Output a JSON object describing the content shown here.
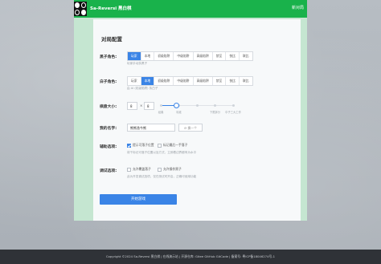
{
  "header": {
    "brand": "Sa-Reversi 黑白棋",
    "new_game": "新对局"
  },
  "config": {
    "title": "对局配置",
    "black_role": {
      "label": "黑子角色:",
      "options": [
        "玩家",
        "本地",
        "初级陷阱",
        "中级陷阱",
        "高级陷阱",
        "禁至",
        "快比",
        "联比"
      ],
      "active_index": 0,
      "hint": "玩家手动执黑子"
    },
    "white_role": {
      "label": "白子角色:",
      "options": [
        "玩家",
        "本地",
        "初级陷阱",
        "中级陷阱",
        "高级陷阱",
        "禁至",
        "快比",
        "联比"
      ],
      "active_index": 1,
      "hint": "由 AI (初级陷阱) 执白子"
    },
    "board_size": {
      "label": "棋盘大小:",
      "rows": "8",
      "times": "×",
      "cols": "8",
      "slider_value_fraction": 0.22,
      "ticks": [
        "经典",
        "标准",
        "",
        "下限拆分",
        "中子三大工作"
      ]
    },
    "name": {
      "label": "我的名字:",
      "value": "熊熊渔今熊",
      "button": "换一个"
    },
    "assist": {
      "label": "辅助选项:",
      "opt1": "提示可落子位置",
      "opt1_checked": true,
      "opt2": "标记最后一手落子",
      "opt2_checked": false,
      "hint": "将千标记可落子位置以及方式，立即着边界都有为水平"
    },
    "debug": {
      "label": "调试选项:",
      "opt1": "允许覆盖落子",
      "opt1_checked": false,
      "opt2": "允许操作黑子",
      "opt2_checked": false,
      "hint": "此为开发调试选项，仅在测试时开启，正确可使用功能"
    },
    "start_button": "开始游戏"
  },
  "footer": {
    "text": "Copyright ©2024 Sa-Reversi 黑白棋 | 在线演示站 | 开源仓库: Gitee GitHub GitCode | 备案号: 粤ICP备18046274号-1"
  },
  "colors": {
    "brand_green": "#19b24b",
    "accent_blue": "#3a84e6",
    "footer_bg": "#2f3237"
  }
}
